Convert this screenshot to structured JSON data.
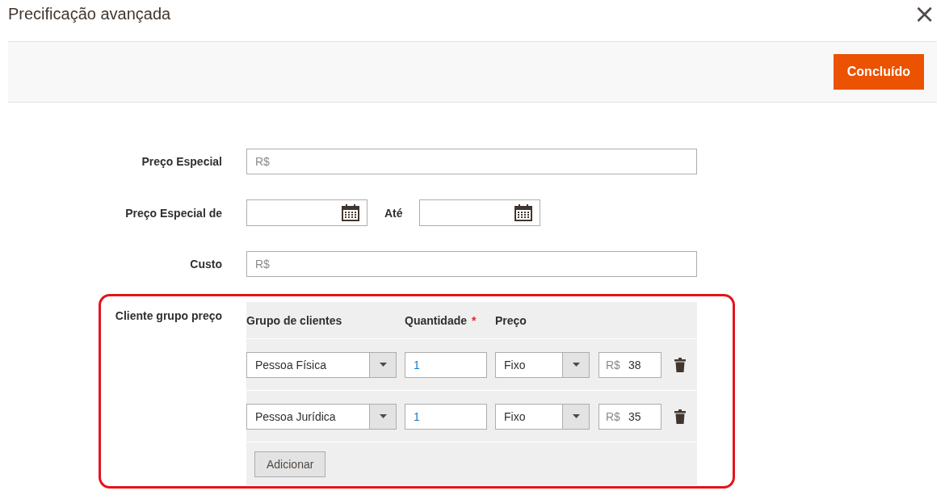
{
  "modal": {
    "title": "Precificação avançada",
    "close": "×"
  },
  "toolbar": {
    "done_button": "Concluído"
  },
  "special_price": {
    "label": "Preço Especial",
    "placeholder": "R$"
  },
  "special_price_dates": {
    "label": "Preço Especial de",
    "to_label": "Até"
  },
  "cost": {
    "label": "Custo",
    "placeholder": "R$"
  },
  "customer_group_price": {
    "label": "Cliente grupo preço",
    "columns": [
      {
        "label": "Grupo de clientes"
      },
      {
        "label": "Quantidade",
        "required_mark": "*"
      },
      {
        "label": "Preço"
      }
    ],
    "rows": [
      {
        "group": "Pessoa Física",
        "quantity": "1",
        "price_type": "Fixo",
        "currency": "R$",
        "price": "38"
      },
      {
        "group": "Pessoa Jurídica",
        "quantity": "1",
        "price_type": "Fixo",
        "currency": "R$",
        "price": "35"
      }
    ],
    "add_button": "Adicionar"
  }
}
